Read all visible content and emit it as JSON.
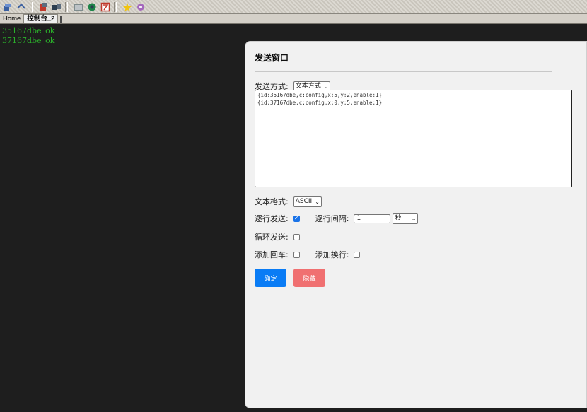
{
  "toolbar": {
    "icons": [
      "connect-icon",
      "disconnect-icon",
      "lock-icon",
      "transfer-icon",
      "terminal-icon",
      "record-icon",
      "script-icon",
      "star-icon",
      "settings-icon"
    ]
  },
  "tabs": [
    {
      "label": "Home"
    },
    {
      "label": "控制台_2"
    }
  ],
  "console": {
    "lines": [
      "35167dbe_ok",
      "37167dbe_ok"
    ]
  },
  "dialog": {
    "title": "发送窗口",
    "send_mode_label": "发送方式:",
    "send_mode_value": "文本方式",
    "content_lines": [
      "{id:35167dbe,c:config,x:5,y:2,enable:1}",
      "{id:37167dbe,c:config,x:0,y:5,enable:1}"
    ],
    "text_format_label": "文本格式:",
    "text_format_value": "ASCII",
    "line_send_label": "逐行发送:",
    "line_send_checked": true,
    "line_interval_label": "逐行间隔:",
    "line_interval_value": "1",
    "interval_unit": "秒",
    "loop_send_label": "循环发送:",
    "loop_send_checked": false,
    "add_cr_label": "添加回车:",
    "add_cr_checked": false,
    "add_lf_label": "添加换行:",
    "add_lf_checked": false,
    "ok_button": "确定",
    "hide_button": "隐藏",
    "colors": {
      "ok": "#0a7cf5",
      "hide": "#f07071",
      "console_text": "#2bb02b"
    }
  }
}
